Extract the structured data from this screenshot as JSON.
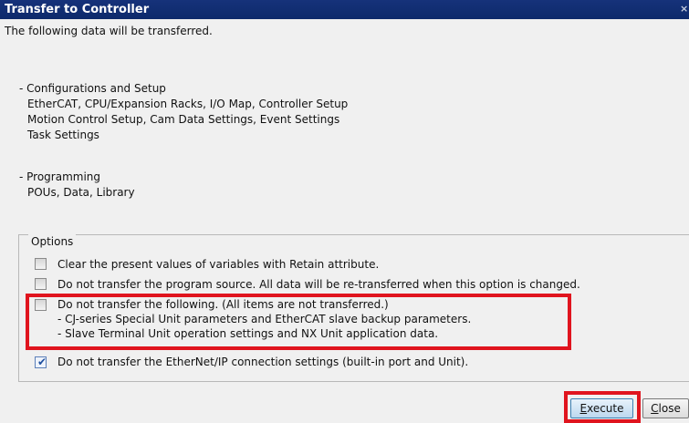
{
  "window": {
    "title": "Transfer to Controller",
    "close_glyph": "×"
  },
  "intro": "The following data will be transferred.",
  "config": {
    "heading": "- Configurations and Setup",
    "lines": [
      "EtherCAT, CPU/Expansion Racks, I/O Map, Controller Setup",
      "Motion Control Setup, Cam Data Settings, Event Settings",
      "Task Settings"
    ]
  },
  "programming": {
    "heading": "- Programming",
    "lines": [
      "POUs, Data, Library"
    ]
  },
  "options": {
    "legend": "Options",
    "items": [
      {
        "label": "Clear the present values of variables with Retain attribute.",
        "checked": false
      },
      {
        "label": "Do not transfer the program source. All data will be re-transferred when this option is changed.",
        "checked": false
      },
      {
        "label": "Do not transfer the following. (All items are not transferred.)",
        "checked": false,
        "sub": [
          "- CJ-series Special Unit parameters and EtherCAT slave backup parameters.",
          "- Slave Terminal Unit operation settings and NX Unit application data."
        ]
      },
      {
        "label": "Do not transfer the EtherNet/IP connection settings (built-in port and Unit).",
        "checked": true
      }
    ]
  },
  "buttons": {
    "execute": {
      "mnemonic": "E",
      "rest": "xecute"
    },
    "close": {
      "mnemonic": "C",
      "rest": "lose"
    }
  },
  "colors": {
    "titlebar": "#0d2a6b",
    "highlight": "#e0141e"
  }
}
